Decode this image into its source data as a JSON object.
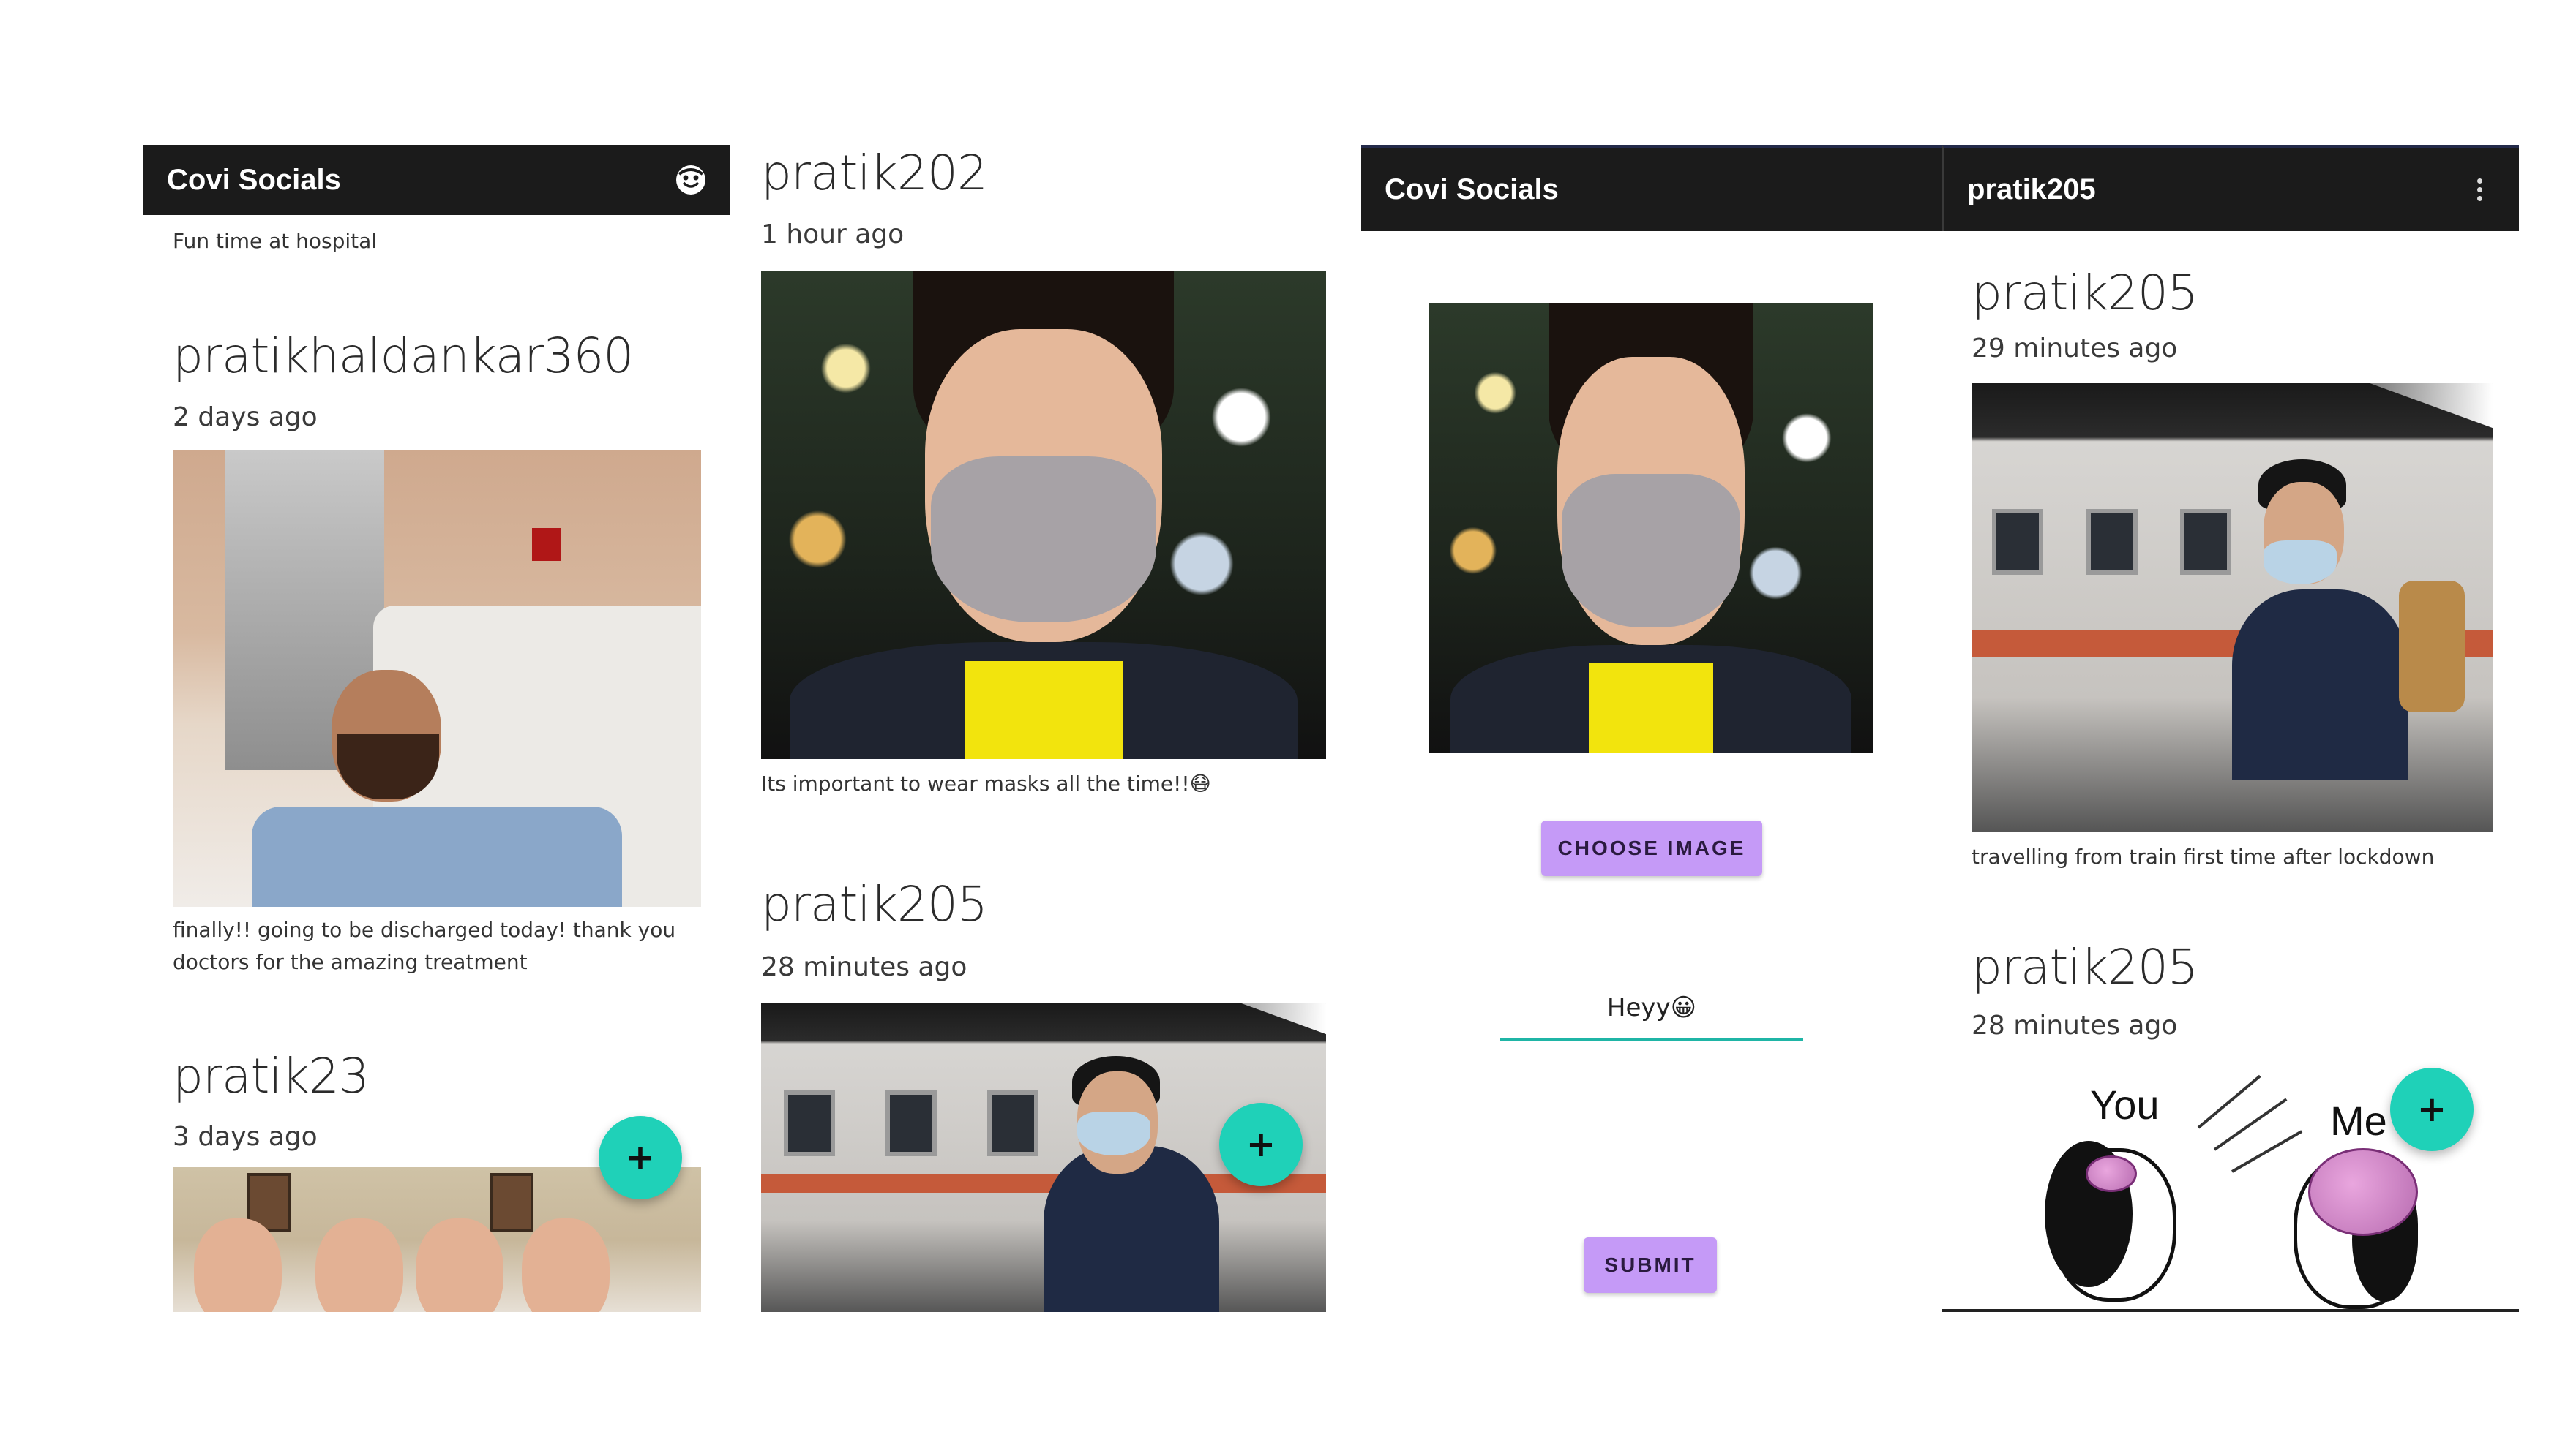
{
  "app": {
    "title": "Covi Socials",
    "profile_icon": "face-icon",
    "menu_icon": "more-vert-icon"
  },
  "screen1": {
    "appbar_title": "Covi Socials",
    "partial_caption": "Fun time at hospital",
    "posts": [
      {
        "username": "pratikhaldankar360",
        "time": "2 days ago",
        "caption": "finally!! going to be discharged today! thank you doctors for the amazing treatment"
      },
      {
        "username": "pratik23",
        "time": "3 days ago"
      }
    ]
  },
  "screen2": {
    "posts": [
      {
        "username": "pratik202",
        "time": "1 hour ago",
        "caption": "Its important to wear masks all the time!!😷"
      },
      {
        "username": "pratik205",
        "time": "28 minutes ago"
      }
    ]
  },
  "screen3": {
    "appbar_title": "Covi Socials",
    "choose_image_label": "CHOOSE IMAGE",
    "caption_input_value": "Heyy😀",
    "submit_label": "SUBMIT"
  },
  "screen4": {
    "appbar_title": "pratik205",
    "posts": [
      {
        "username": "pratik205",
        "time": "29 minutes ago",
        "caption": "travelling from train first time after lockdown"
      },
      {
        "username": "pratik205",
        "time": "28 minutes ago",
        "meme_labels": [
          "You",
          "Me"
        ]
      }
    ]
  },
  "fab_label": "+",
  "colors": {
    "appbar": "#1b1b1b",
    "fab": "#1fd1b8",
    "button": "#c59af7",
    "input_underline": "#1fb5a6"
  }
}
